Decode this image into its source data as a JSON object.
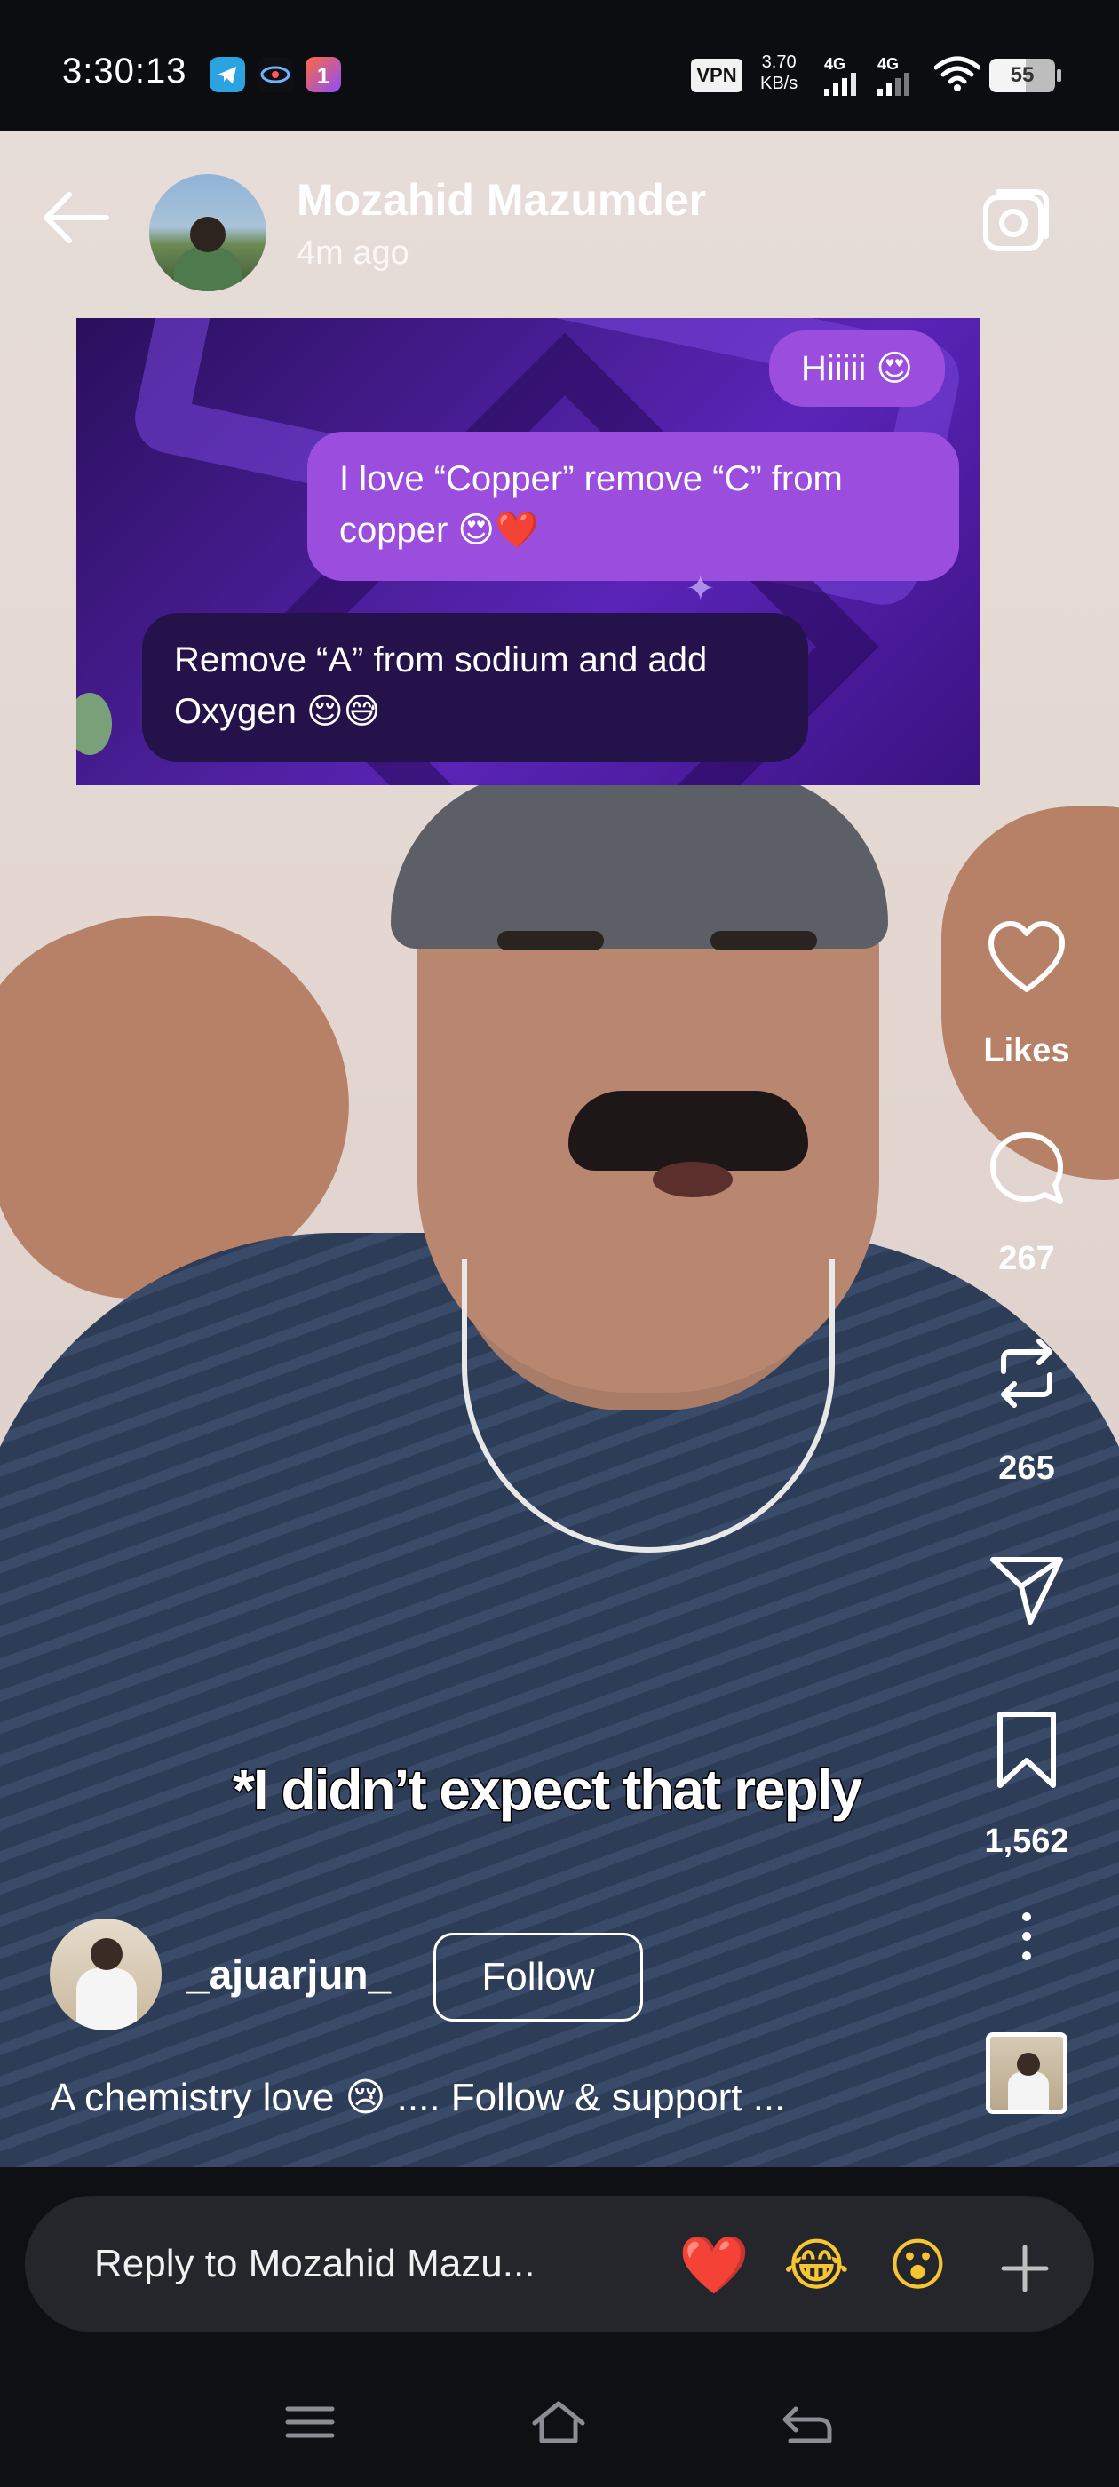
{
  "status_bar": {
    "time": "3:30:13",
    "vpn_label": "VPN",
    "net_speed_value": "3.70",
    "net_speed_unit": "KB/s",
    "signal_1_label": "4G",
    "signal_2_label": "4G",
    "battery_level": "55",
    "app_icons": [
      "telegram-icon",
      "game-app-icon",
      "app-store-icon"
    ]
  },
  "story": {
    "username": "Mozahid Mazumder",
    "time_ago": "4m ago",
    "caption_overlay": "*I didn’t expect that reply"
  },
  "chat_sticker": {
    "messages": [
      {
        "direction": "outgoing",
        "text": "Hiiiii 😍"
      },
      {
        "direction": "outgoing",
        "text_line1": "I love “Copper” remove “C” from",
        "text_line2": "copper 😍❤️"
      },
      {
        "direction": "incoming",
        "text_line1": "Remove “A” from sodium and add",
        "text_line2": "Oxygen 😌😅"
      }
    ]
  },
  "actions": {
    "likes_label": "Likes",
    "comments_count": "267",
    "reposts_count": "265",
    "saves_count": "1,562"
  },
  "post": {
    "author": "_ajuarjun_",
    "follow_label": "Follow",
    "description": "A chemistry love 😢 .... Follow & support ..."
  },
  "reply": {
    "placeholder": "Reply to Mozahid Mazu...",
    "quick_reactions": [
      "❤️",
      "😂",
      "😮"
    ]
  },
  "colors": {
    "accent_purple": "#9b4dde",
    "reply_bar_bg": "#24262b",
    "page_bg": "#0e1014"
  }
}
